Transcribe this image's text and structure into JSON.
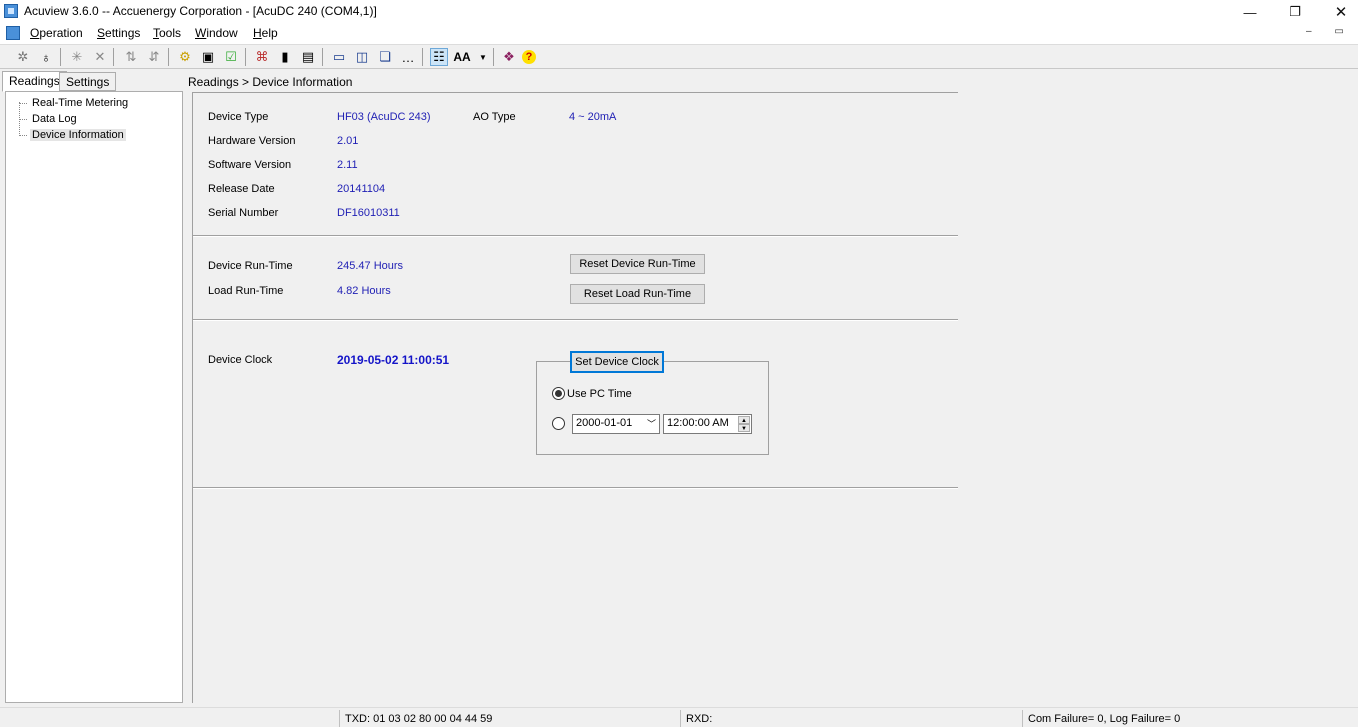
{
  "window": {
    "title": "Acuview 3.6.0 -- Accuenergy Corporation - [AcuDC 240 (COM4,1)]",
    "minimize_glyph": "—",
    "maximize_glyph": "❐",
    "close_glyph": "✕"
  },
  "menu": {
    "items": [
      "Operation",
      "Settings",
      "Tools",
      "Window",
      "Help"
    ],
    "mdi_controls": "– ▭ ✕"
  },
  "toolbar": {
    "icons": [
      "gear-icon",
      "bulb-icon",
      "star-icon",
      "x-icon",
      "split-icon",
      "split2-icon",
      "cog-yellow-icon",
      "monitor-icon",
      "check-icon",
      "network-icon",
      "device-icon",
      "multi-device-icon",
      "layout-h-icon",
      "layout-v-icon",
      "cascade-icon",
      "arrange-icon",
      "tree-toggle-icon",
      "font-icon",
      "dropdown-arrow-icon",
      "book-icon",
      "help-icon"
    ],
    "font_label": "AA",
    "help_label": "?"
  },
  "left_pane": {
    "tabs": [
      "Readings",
      "Settings"
    ],
    "tree": [
      "Real-Time Metering",
      "Data Log",
      "Device Information"
    ]
  },
  "breadcrumb": "Readings > Device Information",
  "device_info": {
    "device_type_label": "Device Type",
    "device_type": "HF03 (AcuDC 243)",
    "ao_type_label": "AO Type",
    "ao_type": "4 ~ 20mA",
    "hardware_version_label": "Hardware Version",
    "hardware_version": "2.01",
    "software_version_label": "Software Version",
    "software_version": "2.11",
    "release_date_label": "Release Date",
    "release_date": "20141104",
    "serial_number_label": "Serial Number",
    "serial_number": "DF16010311"
  },
  "runtime": {
    "device_runtime_label": "Device Run-Time",
    "device_runtime": "245.47 Hours",
    "load_runtime_label": "Load Run-Time",
    "load_runtime": "4.82 Hours",
    "reset_device_button": "Reset Device Run-Time",
    "reset_load_button": "Reset Load Run-Time"
  },
  "clock": {
    "device_clock_label": "Device Clock",
    "device_clock": "2019-05-02 11:00:51",
    "set_clock_button": "Set Device Clock",
    "use_pc_time_label": "Use PC Time",
    "use_pc_time_selected": true,
    "date_value": "2000-01-01",
    "time_value": "12:00:00 AM"
  },
  "status_bar": {
    "txd": "TXD:  01 03 02 80 00 04 44 59",
    "rxd": "RXD:",
    "failures": "Com Failure= 0, Log Failure= 0"
  },
  "colors": {
    "value_text": "#1f1fb4",
    "focus_border": "#0078d7"
  }
}
